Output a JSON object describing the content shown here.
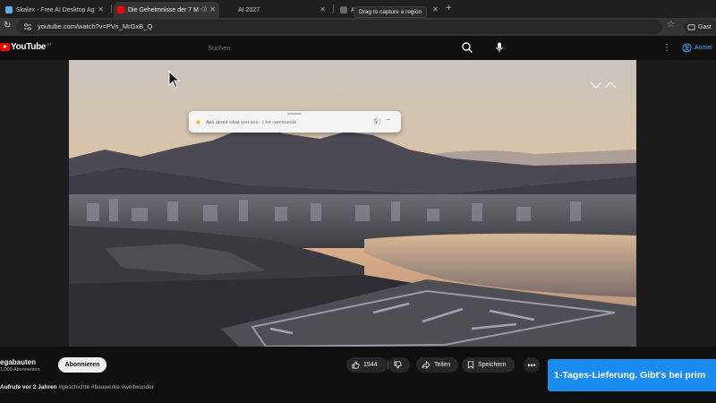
{
  "browser": {
    "tabs": [
      {
        "title": "Skalex - Free AI Desktop Ag"
      },
      {
        "title": "Die Geheimnisse der 7 M"
      },
      {
        "title": "AI 2027"
      },
      {
        "title": "AI"
      }
    ],
    "tooltip": "Drag to capture a region",
    "new_tab": "+",
    "url": "youtube.com/watch?v=PVs_MrGxB_Q",
    "guest_label": "Gast"
  },
  "youtube": {
    "logo_text": "YouTube",
    "country": "AT",
    "search_placeholder": "Suchen",
    "signin_label": "Anmel"
  },
  "overlay": {
    "placeholder": "Ask about what you see - | for commands"
  },
  "video": {
    "channel_name": "egabauten",
    "subscribers": "1.000 Abonnenten",
    "subscribe_label": "Abonnieren",
    "likes": "1544",
    "share_label": "Teilen",
    "save_label": "Speichern",
    "more_label": "•••",
    "views_prefix": "Aufrufe  vor 2 Jahren",
    "hashtags": "#geschichte #bauwerke #weltwunder"
  },
  "ad": {
    "text": "1-Tages-Lieferung. Gibt's bei prim"
  },
  "colors": {
    "youtube_red": "#ff0000",
    "link_blue": "#3ea6ff",
    "ad_blue": "#1a8cf0"
  }
}
